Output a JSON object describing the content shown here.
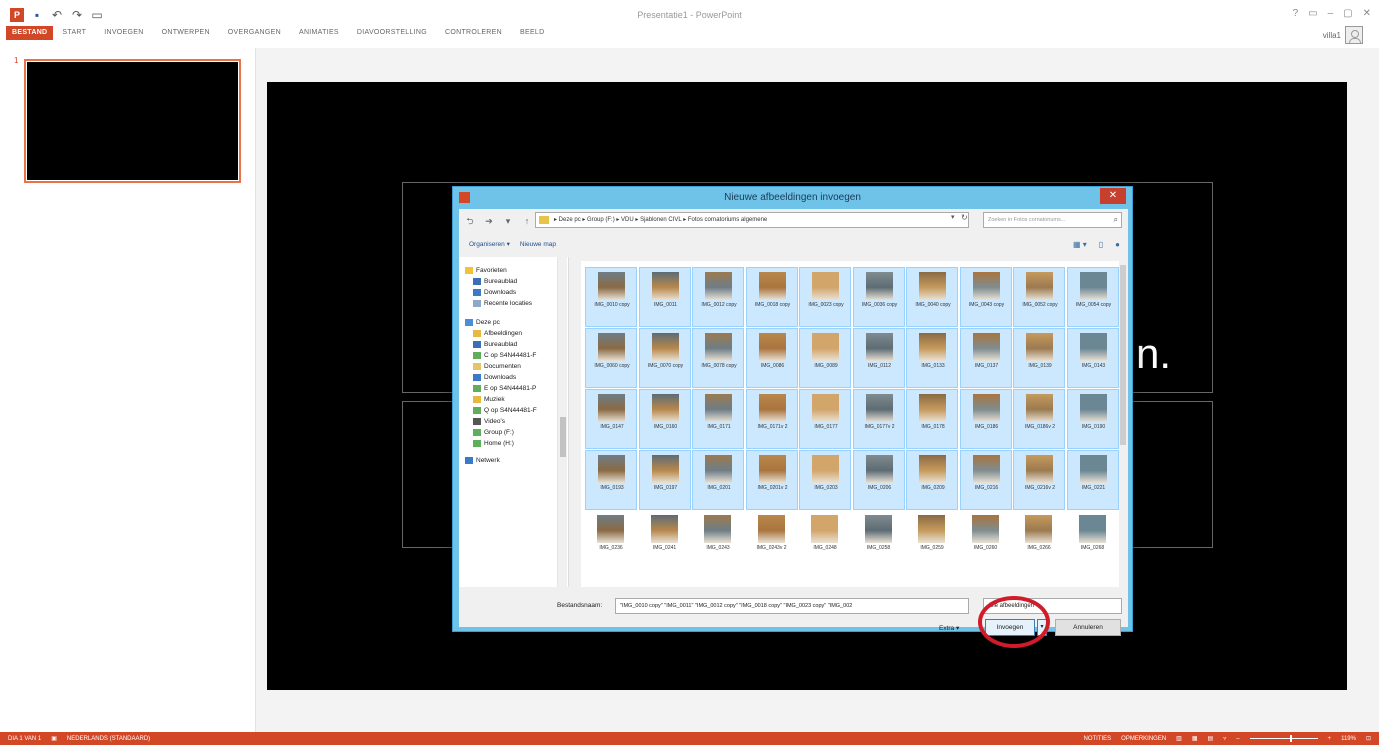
{
  "app": {
    "title": "Presentatie1 - PowerPoint",
    "quick_access": [
      {
        "icon": "powerpoint-icon",
        "glyph": "P"
      },
      {
        "icon": "save-icon",
        "glyph": "▪"
      },
      {
        "icon": "undo-icon",
        "glyph": "↶"
      },
      {
        "icon": "redo-icon",
        "glyph": "↷"
      },
      {
        "icon": "start-slideshow-icon",
        "glyph": "▭"
      }
    ],
    "window_controls": [
      "?",
      "▭",
      "–",
      "▢",
      "✕"
    ],
    "user_name": "villa1",
    "accent_color": "#d24726"
  },
  "ribbon": {
    "tabs": [
      "BESTAND",
      "START",
      "INVOEGEN",
      "ONTWERPEN",
      "OVERGANGEN",
      "ANIMATIES",
      "DIAVOORSTELLING",
      "CONTROLEREN",
      "BEELD"
    ]
  },
  "thumbnails": {
    "slide_number": "1"
  },
  "slide": {
    "text": "n."
  },
  "statusbar": {
    "slide_info": "DIA 1 VAN 1",
    "language": "NEDERLANDS (STANDAARD)",
    "notes": "NOTITIES",
    "comments": "OPMERKINGEN",
    "zoom": "119%"
  },
  "dialog": {
    "title": "Nieuwe afbeeldingen invoegen",
    "nav": {
      "back": "⮌",
      "forward": "➔",
      "recent": "▾",
      "up": "↑"
    },
    "address": "▸ Deze pc ▸ Group (F:) ▸ VDU ▸ Sjablonen CIVL ▸ Fotos cornatoriums algemene",
    "search_placeholder": "Zoeken in Fotos cornatoriums...",
    "toolbar": {
      "organize": "Organiseren ▾",
      "new_folder": "Nieuwe map"
    },
    "nav_pane": [
      {
        "label": "Favorieten",
        "icon": "star-icon",
        "indent": 0
      },
      {
        "label": "Bureaublad",
        "icon": "desktop-icon",
        "indent": 1
      },
      {
        "label": "Downloads",
        "icon": "downloads-icon",
        "indent": 1
      },
      {
        "label": "Recente locaties",
        "icon": "recent-places-icon",
        "indent": 1
      },
      {
        "label": "Deze pc",
        "icon": "computer-icon",
        "indent": 0
      },
      {
        "label": "Afbeeldingen",
        "icon": "pictures-icon",
        "indent": 1
      },
      {
        "label": "Bureaublad",
        "icon": "desktop-icon",
        "indent": 1
      },
      {
        "label": "C op S4N44481-F",
        "icon": "network-drive-icon",
        "indent": 1
      },
      {
        "label": "Documenten",
        "icon": "documents-icon",
        "indent": 1
      },
      {
        "label": "Downloads",
        "icon": "downloads-icon",
        "indent": 1
      },
      {
        "label": "E op S4N44481-P",
        "icon": "network-drive-icon",
        "indent": 1
      },
      {
        "label": "Muziek",
        "icon": "music-icon",
        "indent": 1
      },
      {
        "label": "Q op S4N44481-F",
        "icon": "network-drive-icon",
        "indent": 1
      },
      {
        "label": "Video's",
        "icon": "videos-icon",
        "indent": 1
      },
      {
        "label": "Group (F:)",
        "icon": "network-drive-icon",
        "indent": 1
      },
      {
        "label": "Home (H:)",
        "icon": "network-drive-icon",
        "indent": 1
      },
      {
        "label": "Netwerk",
        "icon": "network-icon",
        "indent": 0
      }
    ],
    "files": [
      {
        "name": "IMG_0010 copy",
        "sel": true
      },
      {
        "name": "IMG_0011",
        "sel": true
      },
      {
        "name": "IMG_0012 copy",
        "sel": true
      },
      {
        "name": "IMG_0018 copy",
        "sel": true
      },
      {
        "name": "IMG_0023 copy",
        "sel": true
      },
      {
        "name": "IMG_0036 copy",
        "sel": true
      },
      {
        "name": "IMG_0040 copy",
        "sel": true
      },
      {
        "name": "IMG_0043 copy",
        "sel": true
      },
      {
        "name": "IMG_0052 copy",
        "sel": true
      },
      {
        "name": "IMG_0054 copy",
        "sel": true
      },
      {
        "name": "IMG_0060 copy",
        "sel": true
      },
      {
        "name": "IMG_0070 copy",
        "sel": true
      },
      {
        "name": "IMG_0078 copy",
        "sel": true
      },
      {
        "name": "IMG_0086",
        "sel": true
      },
      {
        "name": "IMG_0089",
        "sel": true
      },
      {
        "name": "IMG_0112",
        "sel": true
      },
      {
        "name": "IMG_0133",
        "sel": true
      },
      {
        "name": "IMG_0137",
        "sel": true
      },
      {
        "name": "IMG_0139",
        "sel": true
      },
      {
        "name": "IMG_0143",
        "sel": true
      },
      {
        "name": "IMG_0147",
        "sel": true
      },
      {
        "name": "IMG_0160",
        "sel": true
      },
      {
        "name": "IMG_0171",
        "sel": true
      },
      {
        "name": "IMG_0171v 2",
        "sel": true
      },
      {
        "name": "IMG_0177",
        "sel": true
      },
      {
        "name": "IMG_0177v 2",
        "sel": true
      },
      {
        "name": "IMG_0178",
        "sel": true
      },
      {
        "name": "IMG_0186",
        "sel": true
      },
      {
        "name": "IMG_0186v 2",
        "sel": true
      },
      {
        "name": "IMG_0190",
        "sel": true
      },
      {
        "name": "IMG_0193",
        "sel": true
      },
      {
        "name": "IMG_0197",
        "sel": true
      },
      {
        "name": "IMG_0201",
        "sel": true
      },
      {
        "name": "IMG_0201v 2",
        "sel": true
      },
      {
        "name": "IMG_0203",
        "sel": true
      },
      {
        "name": "IMG_0206",
        "sel": true
      },
      {
        "name": "IMG_0209",
        "sel": true
      },
      {
        "name": "IMG_0216",
        "sel": true
      },
      {
        "name": "IMG_0216v 2",
        "sel": true
      },
      {
        "name": "IMG_0221",
        "sel": true
      },
      {
        "name": "IMG_0236",
        "sel": false
      },
      {
        "name": "IMG_0241",
        "sel": false
      },
      {
        "name": "IMG_0243",
        "sel": false
      },
      {
        "name": "IMG_0243v 2",
        "sel": false
      },
      {
        "name": "IMG_0248",
        "sel": false
      },
      {
        "name": "IMG_0258",
        "sel": false
      },
      {
        "name": "IMG_0259",
        "sel": false
      },
      {
        "name": "IMG_0260",
        "sel": false
      },
      {
        "name": "IMG_0266",
        "sel": false
      },
      {
        "name": "IMG_0268",
        "sel": false
      }
    ],
    "filename_label": "Bestandsnaam:",
    "filename_value": "\"IMG_0010 copy\" \"IMG_0011\" \"IMG_0012 copy\" \"IMG_0018 copy\" \"IMG_0023 copy\" \"IMG_002",
    "filter_value": "Alle afbeeldingen",
    "extra_label": "Extra ▾",
    "insert_button": "Invoegen",
    "insert_drop": "▾",
    "cancel_button": "Annuleren"
  }
}
